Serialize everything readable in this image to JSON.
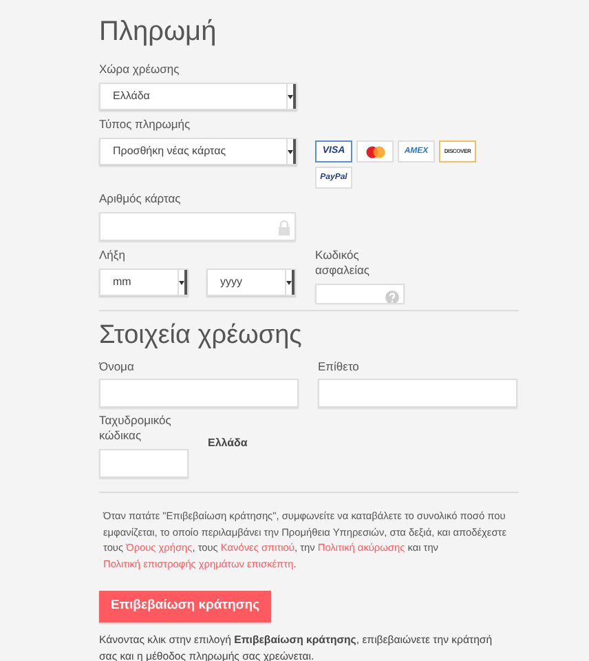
{
  "payment": {
    "title": "Πληρωμή",
    "country": {
      "label": "Χώρα χρέωσης",
      "value": "Ελλάδα"
    },
    "payment_type": {
      "label": "Τύπος πληρωμής",
      "value": "Προσθήκη νέας κάρτας"
    },
    "cards": [
      {
        "kind": "visa",
        "text": "VISA",
        "selected": true
      },
      {
        "kind": "mastercard",
        "selected": false
      },
      {
        "kind": "amex",
        "text": "AMEX",
        "selected": false
      },
      {
        "kind": "discover",
        "text": "DISCOVER",
        "selected": false
      },
      {
        "kind": "paypal",
        "text": "PayPal",
        "selected": false
      }
    ],
    "card_number": {
      "label": "Αριθμός κάρτας"
    },
    "expiry": {
      "label": "Λήξη",
      "month": "mm",
      "year": "yyyy"
    },
    "cvv": {
      "label": "Κωδικός ασφαλείας"
    }
  },
  "billing": {
    "title": "Στοιχεία χρέωσης",
    "first_name": {
      "label": "Όνομα"
    },
    "last_name": {
      "label": "Επίθετο"
    },
    "postal_code": {
      "label": "Ταχυδρομικός κώδικας"
    },
    "country": "Ελλάδα"
  },
  "terms": [
    {
      "kind": "text",
      "text": "Όταν πατάτε \"Επιβεβαίωση κράτησης\", συμφωνείτε να καταβάλετε το συνολικό ποσό που εμφανίζεται, το οποίο περιλαμβάνει την Προμήθεια Υπηρεσιών, στα δεξιά, και αποδέχεστε τους "
    },
    {
      "kind": "link",
      "text": "Όρους χρήσης"
    },
    {
      "kind": "text",
      "text": ", τους "
    },
    {
      "kind": "link",
      "text": "Κανόνες σπιτιού"
    },
    {
      "kind": "text",
      "text": ", την "
    },
    {
      "kind": "link",
      "text": "Πολιτική ακύρωσης"
    },
    {
      "kind": "text",
      "text": " και την "
    },
    {
      "kind": "link",
      "text": "Πολιτική επιστροφής χρημάτων επισκέπτη"
    },
    {
      "kind": "text",
      "text": "."
    }
  ],
  "confirm_button": "Επιβεβαίωση κράτησης",
  "footnote": "Κάνοντας κλικ στην επιλογή **Επιβεβαίωση κράτησης**, επιβεβαιώνετε την κράτησή σας και η μέθοδος πληρωμής σας χρεώνεται."
}
